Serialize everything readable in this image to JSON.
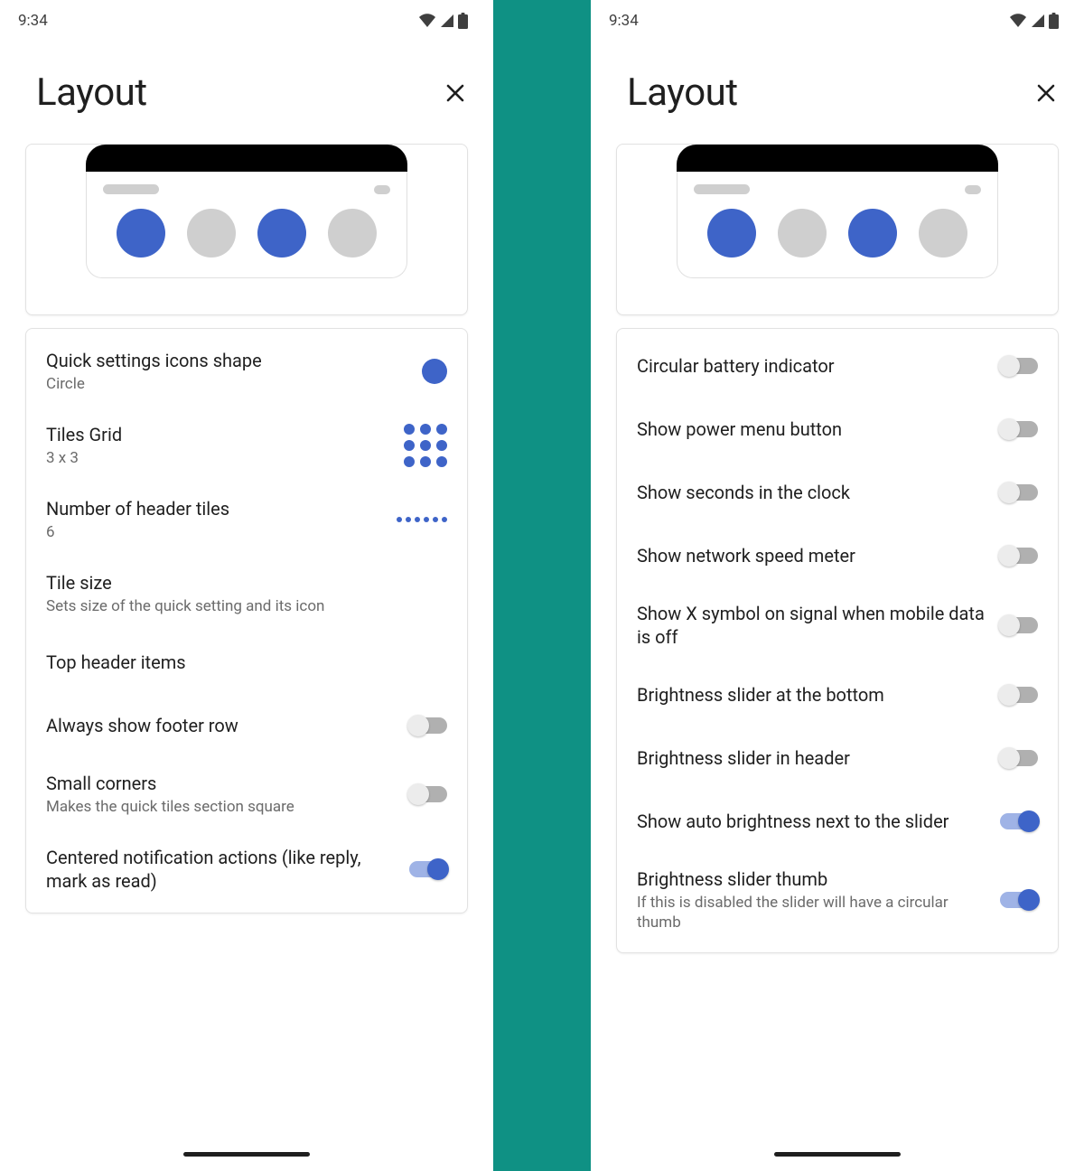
{
  "colors": {
    "accent": "#3e64c8"
  },
  "status": {
    "time": "9:34",
    "time_sep": ":"
  },
  "left": {
    "page_title": "Layout",
    "preview_dots": [
      "blue",
      "grey",
      "blue",
      "grey"
    ],
    "settings": [
      {
        "title": "Quick settings icons shape",
        "subtitle": "Circle",
        "control": "circle"
      },
      {
        "title": "Tiles Grid",
        "subtitle": "3 x 3",
        "control": "grid"
      },
      {
        "title": "Number of header tiles",
        "subtitle": "6",
        "control": "dots"
      },
      {
        "title": "Tile size",
        "subtitle": "Sets size of the quick setting and its icon",
        "control": "none"
      },
      {
        "title": "Top header items",
        "subtitle": "",
        "control": "none"
      },
      {
        "title": "Always show footer row",
        "subtitle": "",
        "control": "switch",
        "value": false
      },
      {
        "title": "Small corners",
        "subtitle": "Makes the quick tiles section square",
        "control": "switch",
        "value": false
      },
      {
        "title": "Centered notification actions (like reply, mark as read)",
        "subtitle": "",
        "control": "switch",
        "value": true
      }
    ]
  },
  "right": {
    "page_title": "Layout",
    "preview_dots": [
      "blue",
      "grey",
      "blue",
      "grey"
    ],
    "settings": [
      {
        "title": "Circular battery indicator",
        "subtitle": "",
        "control": "switch",
        "value": false
      },
      {
        "title": "Show power menu button",
        "subtitle": "",
        "control": "switch",
        "value": false
      },
      {
        "title": "Show seconds in the clock",
        "subtitle": "",
        "control": "switch",
        "value": false
      },
      {
        "title": "Show network speed meter",
        "subtitle": "",
        "control": "switch",
        "value": false
      },
      {
        "title": "Show X symbol on signal when mobile data is off",
        "subtitle": "",
        "control": "switch",
        "value": false
      },
      {
        "title": "Brightness slider at the bottom",
        "subtitle": "",
        "control": "switch",
        "value": false
      },
      {
        "title": "Brightness slider in header",
        "subtitle": "",
        "control": "switch",
        "value": false
      },
      {
        "title": "Show auto brightness next to the slider",
        "subtitle": "",
        "control": "switch",
        "value": true
      },
      {
        "title": "Brightness slider thumb",
        "subtitle": "If this is disabled the slider will have a circular thumb",
        "control": "switch",
        "value": true
      }
    ]
  }
}
